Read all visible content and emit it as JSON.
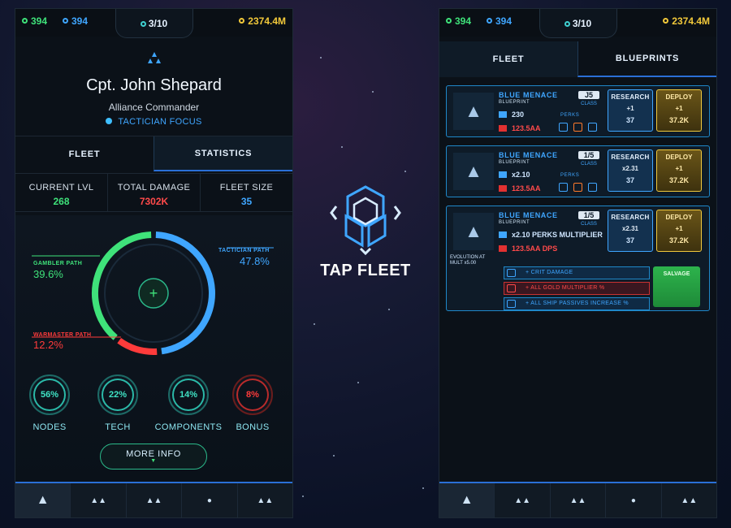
{
  "resources": {
    "green": "394",
    "blue": "394",
    "gold": "2374.4M",
    "page": "3/10"
  },
  "left": {
    "profile": {
      "name": "Cpt. John Shepard",
      "rank": "Alliance Commander",
      "focus": "TACTICIAN FOCUS"
    },
    "tabs": {
      "fleet": "FLEET",
      "statistics": "STATISTICS"
    },
    "stats": [
      {
        "label": "CURRENT LVL",
        "value": "268",
        "color": "#3fe27a"
      },
      {
        "label": "TOTAL DAMAGE",
        "value": "7302K",
        "color": "#ff4a4a"
      },
      {
        "label": "FLEET SIZE",
        "value": "35",
        "color": "#3fa6ff"
      }
    ],
    "paths": {
      "gambler": {
        "label": "GAMBLER PATH",
        "value": "39.6%",
        "color": "#3fe27a",
        "fraction": 0.396
      },
      "tactician": {
        "label": "TACTICIAN PATH",
        "value": "47.8%",
        "color": "#3fa6ff",
        "fraction": 0.478
      },
      "warmaster": {
        "label": "WARMASTER PATH",
        "value": "12.2%",
        "color": "#ff3b3b",
        "fraction": 0.122
      }
    },
    "center_icon": "+",
    "mini": [
      {
        "label": "NODES",
        "value": "56%",
        "color": "#3fe2c4",
        "icon": "nodes-ring"
      },
      {
        "label": "TECH",
        "value": "22%",
        "color": "#3fe2c4",
        "icon": "tech-ring"
      },
      {
        "label": "COMPONENTS",
        "value": "14%",
        "color": "#3fe2c4",
        "icon": "components-ring"
      },
      {
        "label": "BONUS",
        "value": "8%",
        "color": "#ff3b3b",
        "icon": "bonus-ring"
      }
    ],
    "more_info": "MORE INFO"
  },
  "center": {
    "title": "TAP FLEET"
  },
  "right": {
    "tabs": {
      "fleet": "FLEET",
      "blueprints": "BLUEPRINTS"
    },
    "cards": [
      {
        "name": "BLUE MENACE",
        "sub": "BLUEPRINT",
        "cls": "J5",
        "cls_label": "CLASS",
        "stat1": "230",
        "stat2": "123.5AA",
        "perks": "PERKS",
        "research": "RESEARCH",
        "research_mult": "+1",
        "research_cost": "37",
        "deploy": "DEPLOY",
        "deploy_mult": "+1",
        "deploy_cost": "37.2K"
      },
      {
        "name": "BLUE MENACE",
        "sub": "BLUEPRINT",
        "cls": "1/5",
        "cls_label": "CLASS",
        "stat1": "x2.10",
        "stat2": "123.5AA",
        "perks": "PERKS",
        "research": "RESEARCH",
        "research_mult": "x2.31",
        "research_cost": "37",
        "deploy": "DEPLOY",
        "deploy_mult": "+1",
        "deploy_cost": "37.2K"
      },
      {
        "name": "BLUE MENACE",
        "sub": "BLUEPRINT",
        "cls": "1/5",
        "cls_label": "CLASS",
        "stat1": "x2.10 PERKS MULTIPLIER",
        "stat2": "123.5AA DPS",
        "research": "RESEARCH",
        "research_mult": "x2.31",
        "research_cost": "37",
        "deploy": "DEPLOY",
        "deploy_mult": "+1",
        "deploy_cost": "37.2K",
        "evolution_label": "EVOLUTION AT",
        "mult_label": "MULT x5.00",
        "perk_rows": [
          "+ CRIT DAMAGE",
          "+ ALL GOLD MULTIPLIER %",
          "+ ALL SHIP PASSIVES INCREASE %"
        ],
        "salvage": "SALVAGE"
      }
    ]
  }
}
